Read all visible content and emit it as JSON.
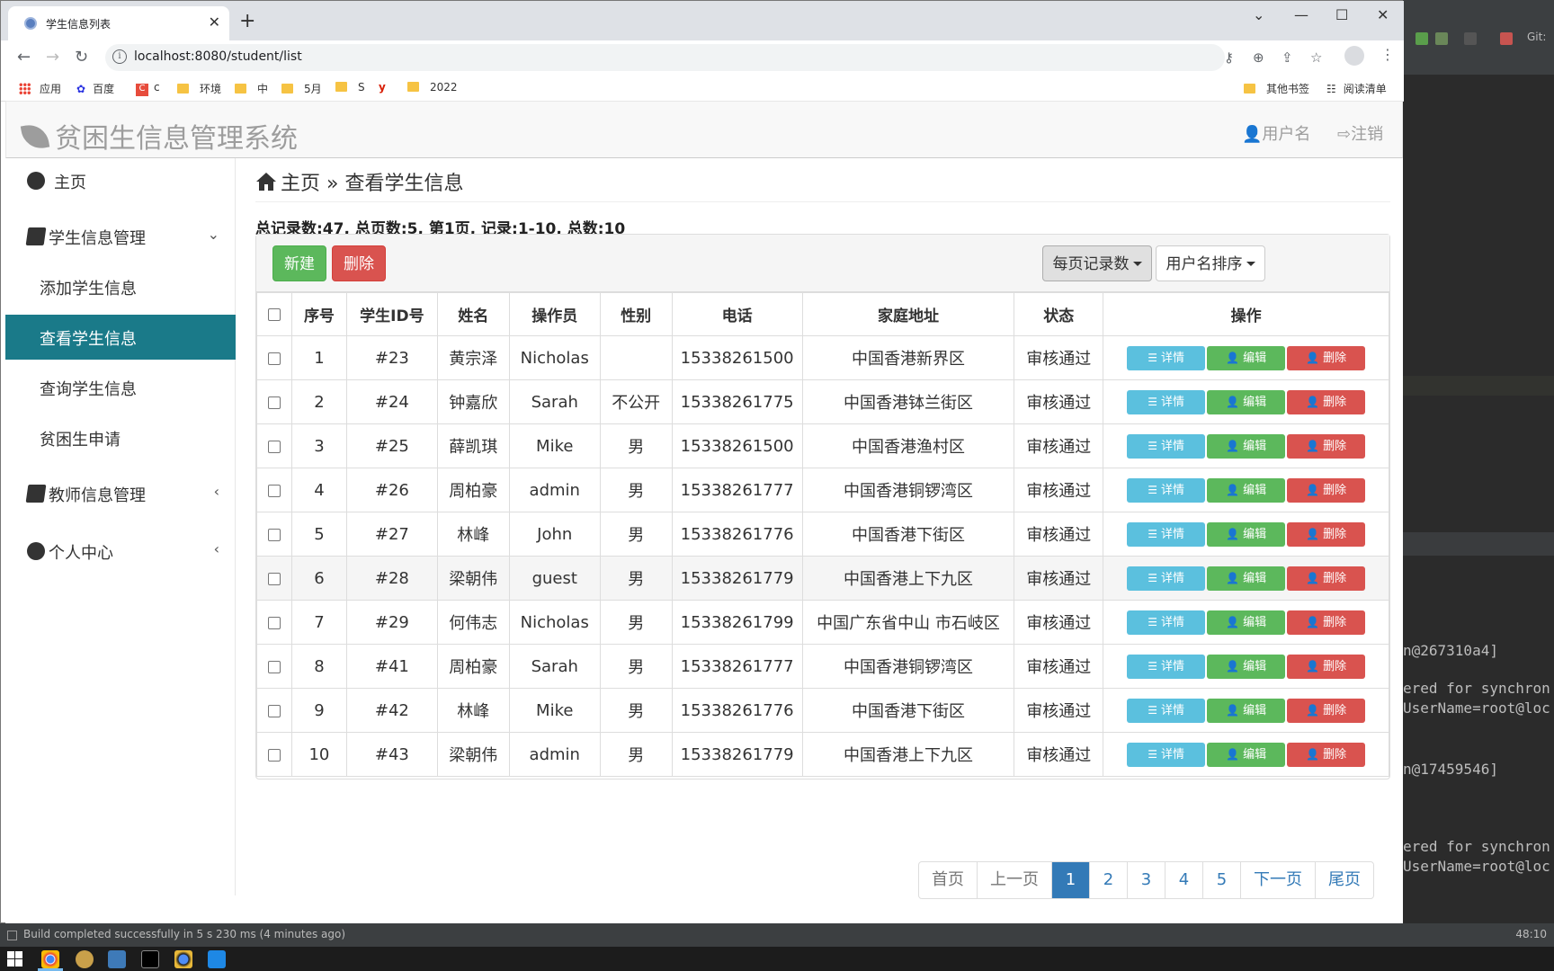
{
  "browser": {
    "tab_title": "学生信息列表",
    "url": "localhost:8080/student/list",
    "bookmarks": [
      {
        "label": "应用",
        "icon": "apps-icon"
      },
      {
        "label": "百度",
        "icon": "baidu-icon"
      },
      {
        "label": "c",
        "icon": "c-icon"
      },
      {
        "label": "环境",
        "icon": "folder-icon"
      },
      {
        "label": "中",
        "icon": "folder-icon"
      },
      {
        "label": "5月",
        "icon": "folder-icon"
      },
      {
        "label": "S",
        "icon": "folder-icon"
      },
      {
        "label": "",
        "icon": "y-icon"
      },
      {
        "label": "2022",
        "icon": "folder-icon"
      }
    ],
    "bookmarks_right": [
      {
        "label": "其他书签",
        "icon": "folder-icon"
      },
      {
        "label": "阅读清单",
        "icon": "reading-list-icon"
      }
    ]
  },
  "app": {
    "brand": "贫困生信息管理系统",
    "nav_user": "用户名",
    "nav_logout": "注销"
  },
  "sidebar": {
    "home": "主页",
    "student_mgmt": "学生信息管理",
    "sub": [
      "添加学生信息",
      "查看学生信息",
      "查询学生信息",
      "贫困生申请"
    ],
    "teacher_mgmt": "教师信息管理",
    "personal": "个人中心"
  },
  "main": {
    "breadcrumb_home": "主页",
    "breadcrumb_sep": "»",
    "breadcrumb_current": "查看学生信息",
    "summary": "总记录数:47, 总页数:5, 第1页, 记录:1-10, 总数:10",
    "btn_new": "新建",
    "btn_delete": "删除",
    "btn_per_page": "每页记录数",
    "btn_sort": "用户名排序"
  },
  "table": {
    "headers": [
      "序号",
      "学生ID号",
      "姓名",
      "操作员",
      "性别",
      "电话",
      "家庭地址",
      "状态",
      "操作"
    ],
    "action_labels": {
      "detail": "详情",
      "edit": "编辑",
      "delete": "删除"
    },
    "rows": [
      [
        "1",
        "#23",
        "黄宗泽",
        "Nicholas",
        "",
        "15338261500",
        "中国香港新界区",
        "审核通过"
      ],
      [
        "2",
        "#24",
        "钟嘉欣",
        "Sarah",
        "不公开",
        "15338261775",
        "中国香港钵兰街区",
        "审核通过"
      ],
      [
        "3",
        "#25",
        "薛凯琪",
        "Mike",
        "男",
        "15338261500",
        "中国香港渔村区",
        "审核通过"
      ],
      [
        "4",
        "#26",
        "周柏豪",
        "admin",
        "男",
        "15338261777",
        "中国香港铜锣湾区",
        "审核通过"
      ],
      [
        "5",
        "#27",
        "林峰",
        "John",
        "男",
        "15338261776",
        "中国香港下街区",
        "审核通过"
      ],
      [
        "6",
        "#28",
        "梁朝伟",
        "guest",
        "男",
        "15338261779",
        "中国香港上下九区",
        "审核通过"
      ],
      [
        "7",
        "#29",
        "何伟志",
        "Nicholas",
        "男",
        "15338261799",
        "中国广东省中山 市石岐区",
        "审核通过"
      ],
      [
        "8",
        "#41",
        "周柏豪",
        "Sarah",
        "男",
        "15338261777",
        "中国香港铜锣湾区",
        "审核通过"
      ],
      [
        "9",
        "#42",
        "林峰",
        "Mike",
        "男",
        "15338261776",
        "中国香港下街区",
        "审核通过"
      ],
      [
        "10",
        "#43",
        "梁朝伟",
        "admin",
        "男",
        "15338261779",
        "中国香港上下九区",
        "审核通过"
      ]
    ],
    "highlight_row": 6
  },
  "pagination": {
    "first": "首页",
    "prev": "上一页",
    "pages": [
      "1",
      "2",
      "3",
      "4",
      "5"
    ],
    "current": "1",
    "next": "下一页",
    "last": "尾页"
  },
  "ide": {
    "git_label": "Git:",
    "console_lines": [
      "n@267310a4]",
      "ered for synchron",
      "UserName=root@loc",
      "n@17459546]",
      "ered for synchron",
      "UserName=root@loc"
    ],
    "status_text": "Build completed successfully in 5 s 230 ms (4 minutes ago)",
    "status_pos": "48:10"
  },
  "colors": {
    "active_sidebar": "#1a7a89",
    "success": "#5cb85c",
    "danger": "#d9534f",
    "info": "#5bc0de",
    "primary": "#337ab7"
  }
}
